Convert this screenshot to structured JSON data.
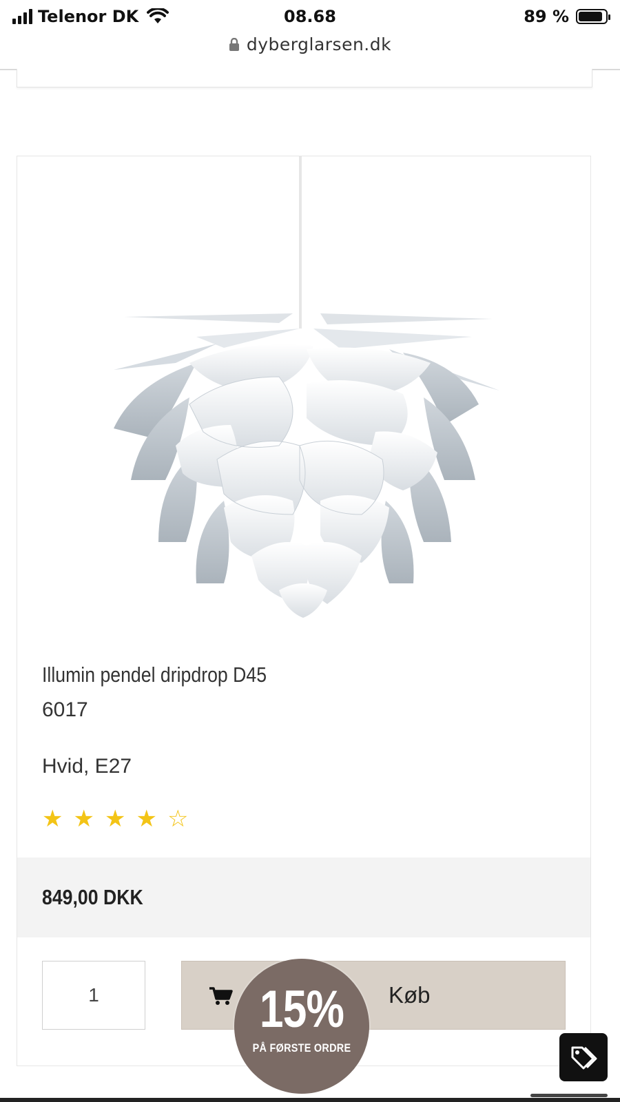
{
  "status_bar": {
    "carrier": "Telenor DK",
    "time": "08.68",
    "battery_percent": "89 %",
    "battery_level": 0.89
  },
  "browser": {
    "url": "dyberglarsen.dk"
  },
  "product": {
    "title": "Illumin pendel dripdrop D45",
    "sku": "6017",
    "variant": "Hvid, E27",
    "rating": 4,
    "rating_max": 5,
    "price": "849,00 DKK",
    "quantity": "1",
    "buy_label": "Køb"
  },
  "badge": {
    "percent": "15%",
    "subtitle": "PÅ FØRSTE ORDRE",
    "color": "#7b6b65"
  },
  "icons": {
    "cart": "cart-icon",
    "tag": "tag-icon",
    "lock": "lock-icon",
    "wifi": "wifi-icon"
  }
}
